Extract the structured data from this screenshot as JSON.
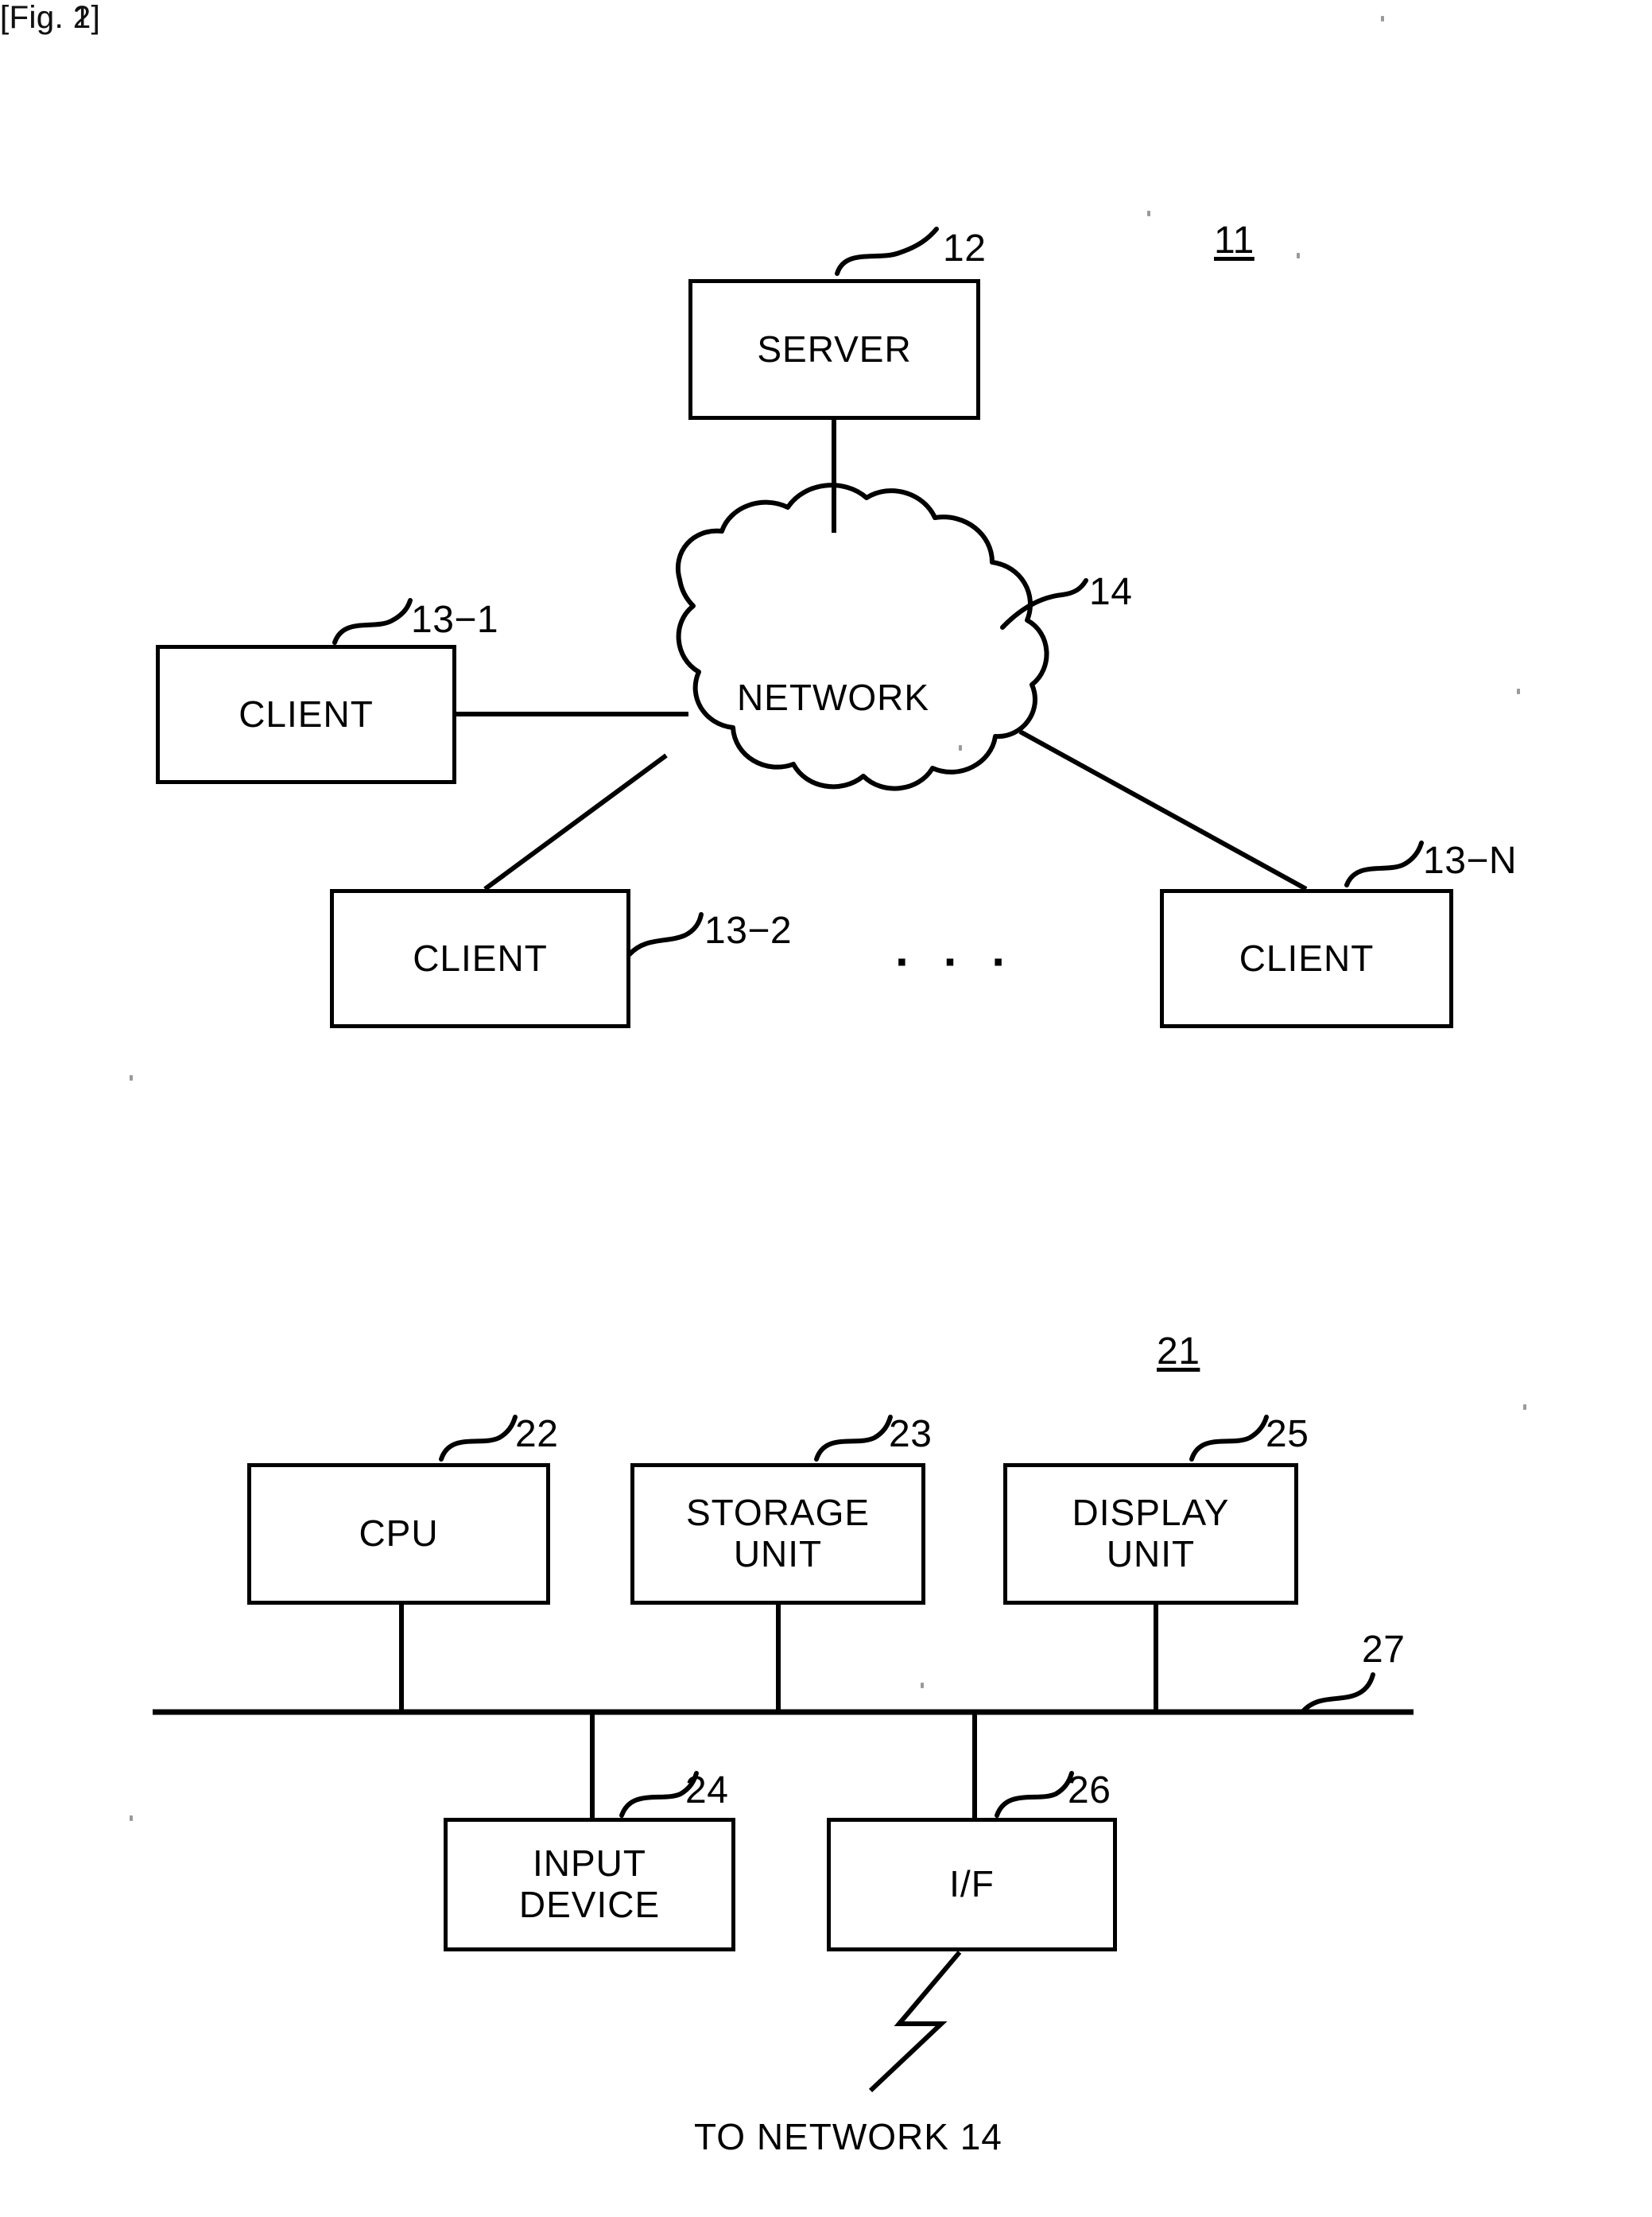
{
  "figures": [
    {
      "label": "[Fig. 1]",
      "system_ref": "11",
      "nodes": {
        "server": {
          "text": "SERVER",
          "ref": "12"
        },
        "network": {
          "text": "NETWORK",
          "ref": "14"
        },
        "client_1": {
          "text": "CLIENT",
          "ref": "13−1"
        },
        "client_2": {
          "text": "CLIENT",
          "ref": "13−2"
        },
        "client_n": {
          "text": "CLIENT",
          "ref": "13−N"
        }
      },
      "ellipsis": "· · ·"
    },
    {
      "label": "[Fig. 2]",
      "system_ref": "21",
      "nodes": {
        "cpu": {
          "text": "CPU",
          "ref": "22"
        },
        "storage_unit": {
          "text": "STORAGE\nUNIT",
          "ref": "23"
        },
        "display_unit": {
          "text": "DISPLAY\nUNIT",
          "ref": "25"
        },
        "input_device": {
          "text": "INPUT\nDEVICE",
          "ref": "24"
        },
        "interface": {
          "text": "I/F",
          "ref": "26"
        },
        "bus": {
          "ref": "27"
        }
      },
      "caption": "TO NETWORK 14"
    }
  ],
  "colors": {
    "ink": "#000000",
    "paper": "#ffffff"
  }
}
